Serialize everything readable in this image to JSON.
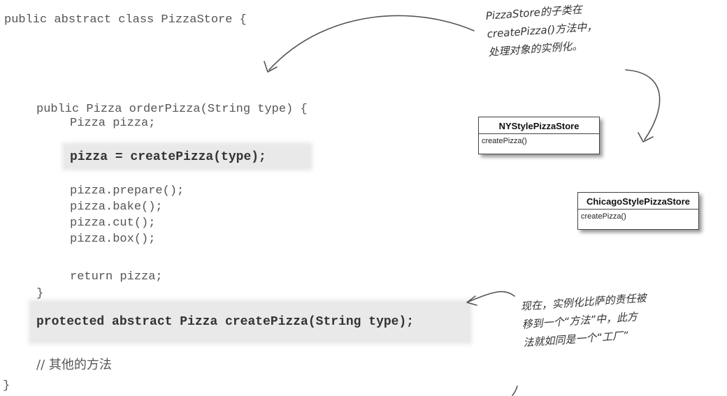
{
  "code": {
    "class_decl": "public abstract class PizzaStore {",
    "method_decl": "public Pizza orderPizza(String type) {",
    "var_decl": "Pizza pizza;",
    "create_call": "pizza = createPizza(type);",
    "prepare": "pizza.prepare();",
    "bake": "pizza.bake();",
    "cut": "pizza.cut();",
    "box": "pizza.box();",
    "return_stmt": "return pizza;",
    "method_close": "}",
    "abstract_decl": "protected abstract Pizza createPizza(String type);",
    "comment": "// 其他的方法",
    "class_close": "}"
  },
  "notes": {
    "top": "PizzaStore的子类在\ncreatePizza()方法中，\n处理对象的实例化。",
    "bottom": "现在，实例化比萨的责任被\n移到一个“方法”中，此方\n法就如同是一个“工厂”"
  },
  "classes": [
    {
      "name": "NYStylePizzaStore",
      "method": "createPizza()"
    },
    {
      "name": "ChicagoStylePizzaStore",
      "method": "createPizza()"
    }
  ]
}
